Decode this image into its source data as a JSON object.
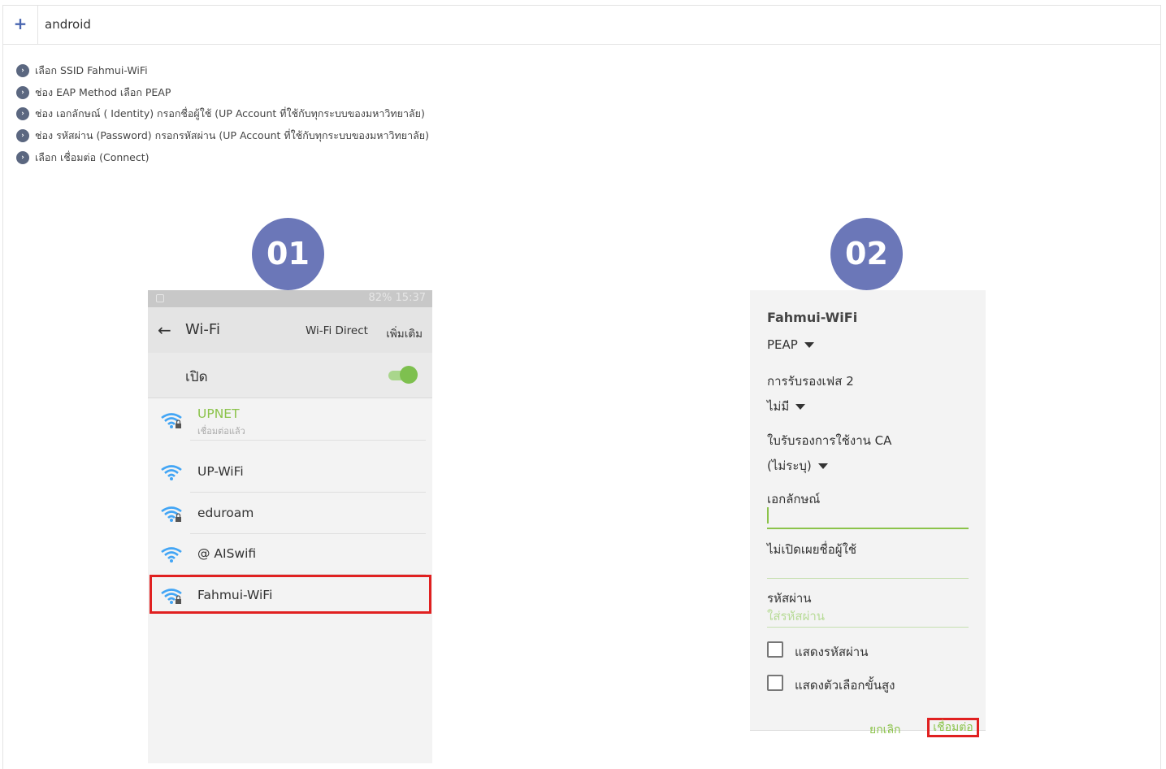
{
  "header": {
    "plus": "+",
    "title": "android"
  },
  "steps": [
    "เลือก SSID Fahmui-WiFi",
    "ช่อง EAP Method เลือก PEAP",
    "ช่อง เอกลักษณ์ ( Identity) กรอกชื่อผู้ใช้ (UP Account ที่ใช้กับทุกระบบของมหาวิทยาลัย)",
    "ช่อง รหัสผ่าน (Password) กรอกรหัสผ่าน (UP Account ที่ใช้กับทุกระบบของมหาวิทยาลัย)",
    "เลือก เชื่อมต่อ (Connect)"
  ],
  "badges": {
    "first": "01",
    "second": "02"
  },
  "phone1": {
    "status": "82% 15:37",
    "title": "Wi-Fi",
    "wifi_direct": "Wi-Fi Direct",
    "more": "เพิ่มเติม",
    "toggle_label": "เปิด",
    "toggle_on": true,
    "networks": [
      {
        "name": "UPNET",
        "sub": "เชื่อมต่อแล้ว",
        "secured": true
      },
      {
        "name": "UP-WiFi",
        "sub": "",
        "secured": false
      },
      {
        "name": "eduroam",
        "sub": "",
        "secured": true
      },
      {
        "name": "@ AISwifi",
        "sub": "",
        "secured": false
      },
      {
        "name": "Fahmui-WiFi",
        "sub": "",
        "secured": true
      }
    ],
    "accent": "#8bc34a",
    "highlight_color": "#e02020"
  },
  "phone2": {
    "ssid": "Fahmui-WiFi",
    "eap_method": "PEAP",
    "phase2_label": "การรับรองเฟส 2",
    "phase2_value": "ไม่มี",
    "ca_label": "ใบรับรองการใช้งาน CA",
    "ca_value": "(ไม่ระบุ)",
    "identity_label": "เอกลักษณ์",
    "anonymous_label": "ไม่เปิดเผยชื่อผู้ใช้",
    "password_label": "รหัสผ่าน",
    "password_placeholder": "ใส่รหัสผ่าน",
    "show_password": "แสดงรหัสผ่าน",
    "show_advanced": "แสดงตัวเลือกขั้นสูง",
    "cancel": "ยกเลิก",
    "connect": "เชื่อมต่อ"
  }
}
